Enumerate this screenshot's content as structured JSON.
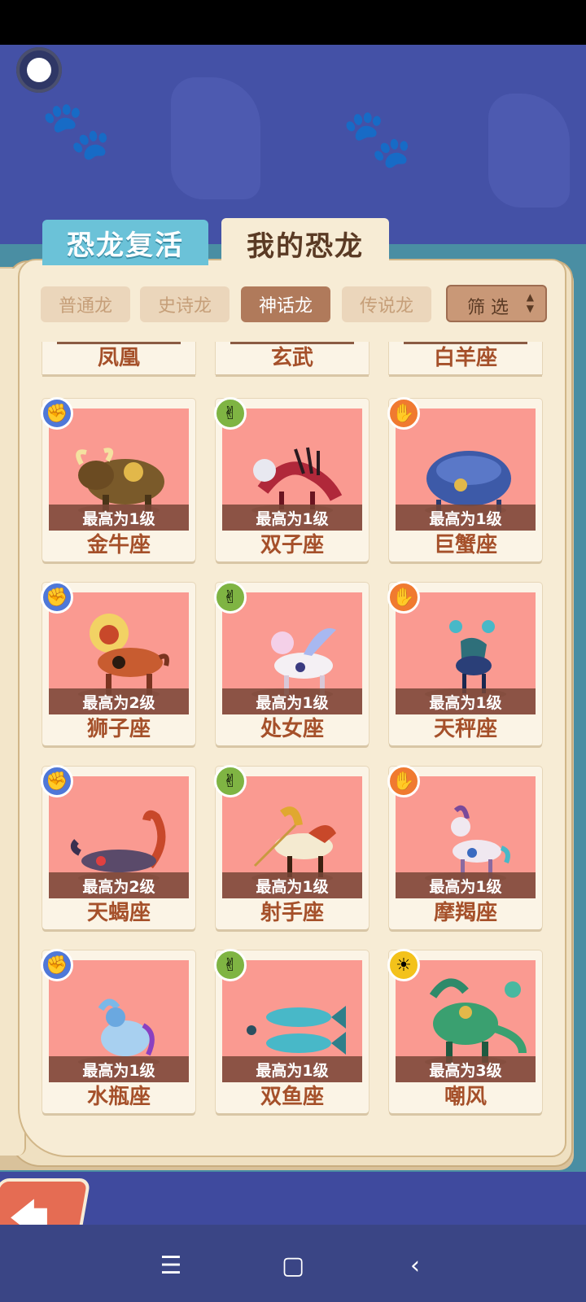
{
  "main_tabs": [
    {
      "label": "恐龙复活",
      "active": false
    },
    {
      "label": "我的恐龙",
      "active": true
    }
  ],
  "sub_tabs": [
    {
      "label": "普通龙",
      "active": false
    },
    {
      "label": "史诗龙",
      "active": false
    },
    {
      "label": "神话龙",
      "active": true
    },
    {
      "label": "传说龙",
      "active": false
    }
  ],
  "filter": {
    "label": "筛 选",
    "arrows_icon": "sort-arrows-icon"
  },
  "partial_row": [
    "凤凰",
    "玄武",
    "白羊座"
  ],
  "cards": [
    {
      "name": "金牛座",
      "level": "最高为1级",
      "badge": "rock-fist-icon"
    },
    {
      "name": "双子座",
      "level": "最高为1级",
      "badge": "scissors-hand-icon"
    },
    {
      "name": "巨蟹座",
      "level": "最高为1级",
      "badge": "paper-hand-icon"
    },
    {
      "name": "狮子座",
      "level": "最高为2级",
      "badge": "rock-fist-icon"
    },
    {
      "name": "处女座",
      "level": "最高为1级",
      "badge": "scissors-hand-icon"
    },
    {
      "name": "天秤座",
      "level": "最高为1级",
      "badge": "paper-hand-icon"
    },
    {
      "name": "天蝎座",
      "level": "最高为2级",
      "badge": "rock-fist-icon"
    },
    {
      "name": "射手座",
      "level": "最高为1级",
      "badge": "scissors-hand-icon"
    },
    {
      "name": "摩羯座",
      "level": "最高为1级",
      "badge": "paper-hand-icon"
    },
    {
      "name": "水瓶座",
      "level": "最高为1级",
      "badge": "rock-fist-icon"
    },
    {
      "name": "双鱼座",
      "level": "最高为1级",
      "badge": "scissors-hand-icon"
    },
    {
      "name": "嘲风",
      "level": "最高为3级",
      "badge": "sun-icon"
    }
  ],
  "colors": {
    "card_bg": "#fa9a91",
    "tab_active": "#b07a5b",
    "revive_tab": "#6bc2d8",
    "name_text": "#a5502a",
    "background": "#4451a6"
  },
  "nav_icons": [
    "menu-icon",
    "home-square-icon",
    "back-chevron-icon"
  ]
}
